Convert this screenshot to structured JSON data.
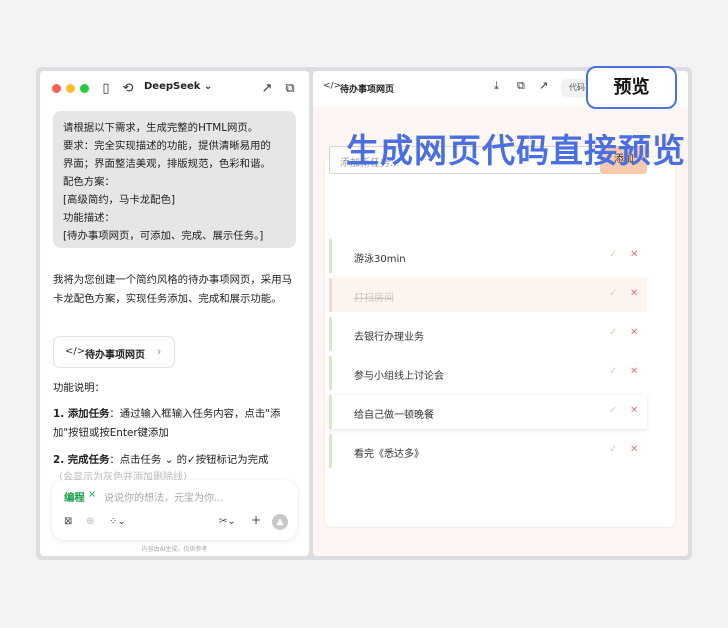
{
  "left": {
    "model_name": "DeepSeek",
    "user_message": [
      "请根据以下需求，生成完整的HTML网页。",
      "要求：完全实现描述的功能，提供清晰易用的",
      "界面；界面整洁美观，排版规范，色彩和谐。",
      "配色方案：",
      "[高级简约，马卡龙配色]",
      "功能描述：",
      "[待办事项网页，可添加、完成、展示任务。]"
    ],
    "reply_intro": "我将为您创建一个简约风格的待办事项网页，采用马卡龙配色方案，实现任务添加、完成和展示功能。",
    "card_label": "待办事项网页",
    "func_title": "功能说明：",
    "func1_label": "1. 添加任务",
    "func1_text": "：通过输入框输入任务内容，点击\"添加\"按钮或按Enter键添加",
    "func2_label": "2. 完成任务",
    "func2_text": "：点击任务",
    "func2_text_tail": "的✓按钮标记为完成",
    "func2_fade": "（会显示为灰色并添加删除线）",
    "input_tag": "编程",
    "input_placeholder": "说说你的想法，元宝为你...",
    "disclaimer": "内容由AI生成，仅供参考"
  },
  "right": {
    "tab_title": "待办事项网页",
    "code_tab": "代码",
    "todo_placeholder": "添加新任务...",
    "add_button": "添加",
    "tasks": [
      {
        "text": "游泳30min",
        "done": false
      },
      {
        "text": "打扫房间",
        "done": true
      },
      {
        "text": "去银行办理业务",
        "done": false
      },
      {
        "text": "参与小组线上讨论会",
        "done": false
      },
      {
        "text": "给自己做一顿晚餐",
        "done": false
      },
      {
        "text": "看完《悉达多》",
        "done": false
      }
    ]
  },
  "overlay": {
    "headline": "生成网页代码直接预览",
    "badge": "预览"
  },
  "colors": {
    "accent_blue": "#4a6fe3",
    "add_button": "#f9c9ad",
    "preview_bg": "#fdf6f2"
  }
}
